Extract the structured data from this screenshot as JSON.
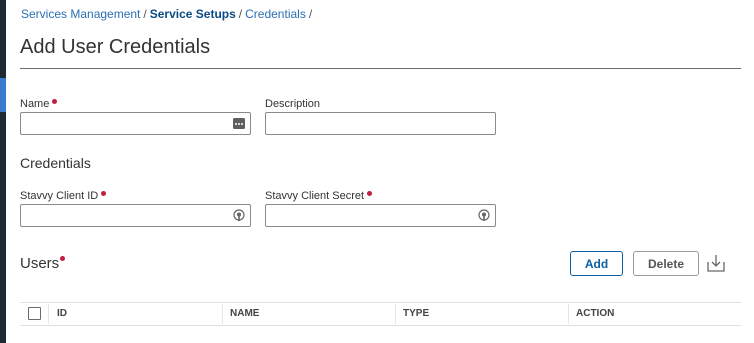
{
  "breadcrumb": {
    "items": [
      "Services Management",
      "Service Setups",
      "Credentials"
    ],
    "separator": "/"
  },
  "page": {
    "title": "Add User Credentials"
  },
  "form": {
    "name": {
      "label": "Name",
      "value": "",
      "required": true,
      "icon": "password-manager-icon"
    },
    "description": {
      "label": "Description",
      "value": ""
    },
    "credentials_section": "Credentials",
    "client_id": {
      "label": "Stavvy Client ID",
      "value": "",
      "required": true,
      "icon": "secret-key-icon"
    },
    "client_secret": {
      "label": "Stavvy Client Secret",
      "value": "",
      "required": true,
      "icon": "secret-key-icon"
    }
  },
  "users": {
    "title": "Users",
    "required": true,
    "add_label": "Add",
    "delete_label": "Delete",
    "export_icon": "export-icon",
    "columns": [
      "ID",
      "NAME",
      "TYPE",
      "ACTION"
    ]
  },
  "colors": {
    "link": "#2a6fb5",
    "required": "#c21d45",
    "primary": "#0b5fa5",
    "rail": "#1f2a33"
  }
}
